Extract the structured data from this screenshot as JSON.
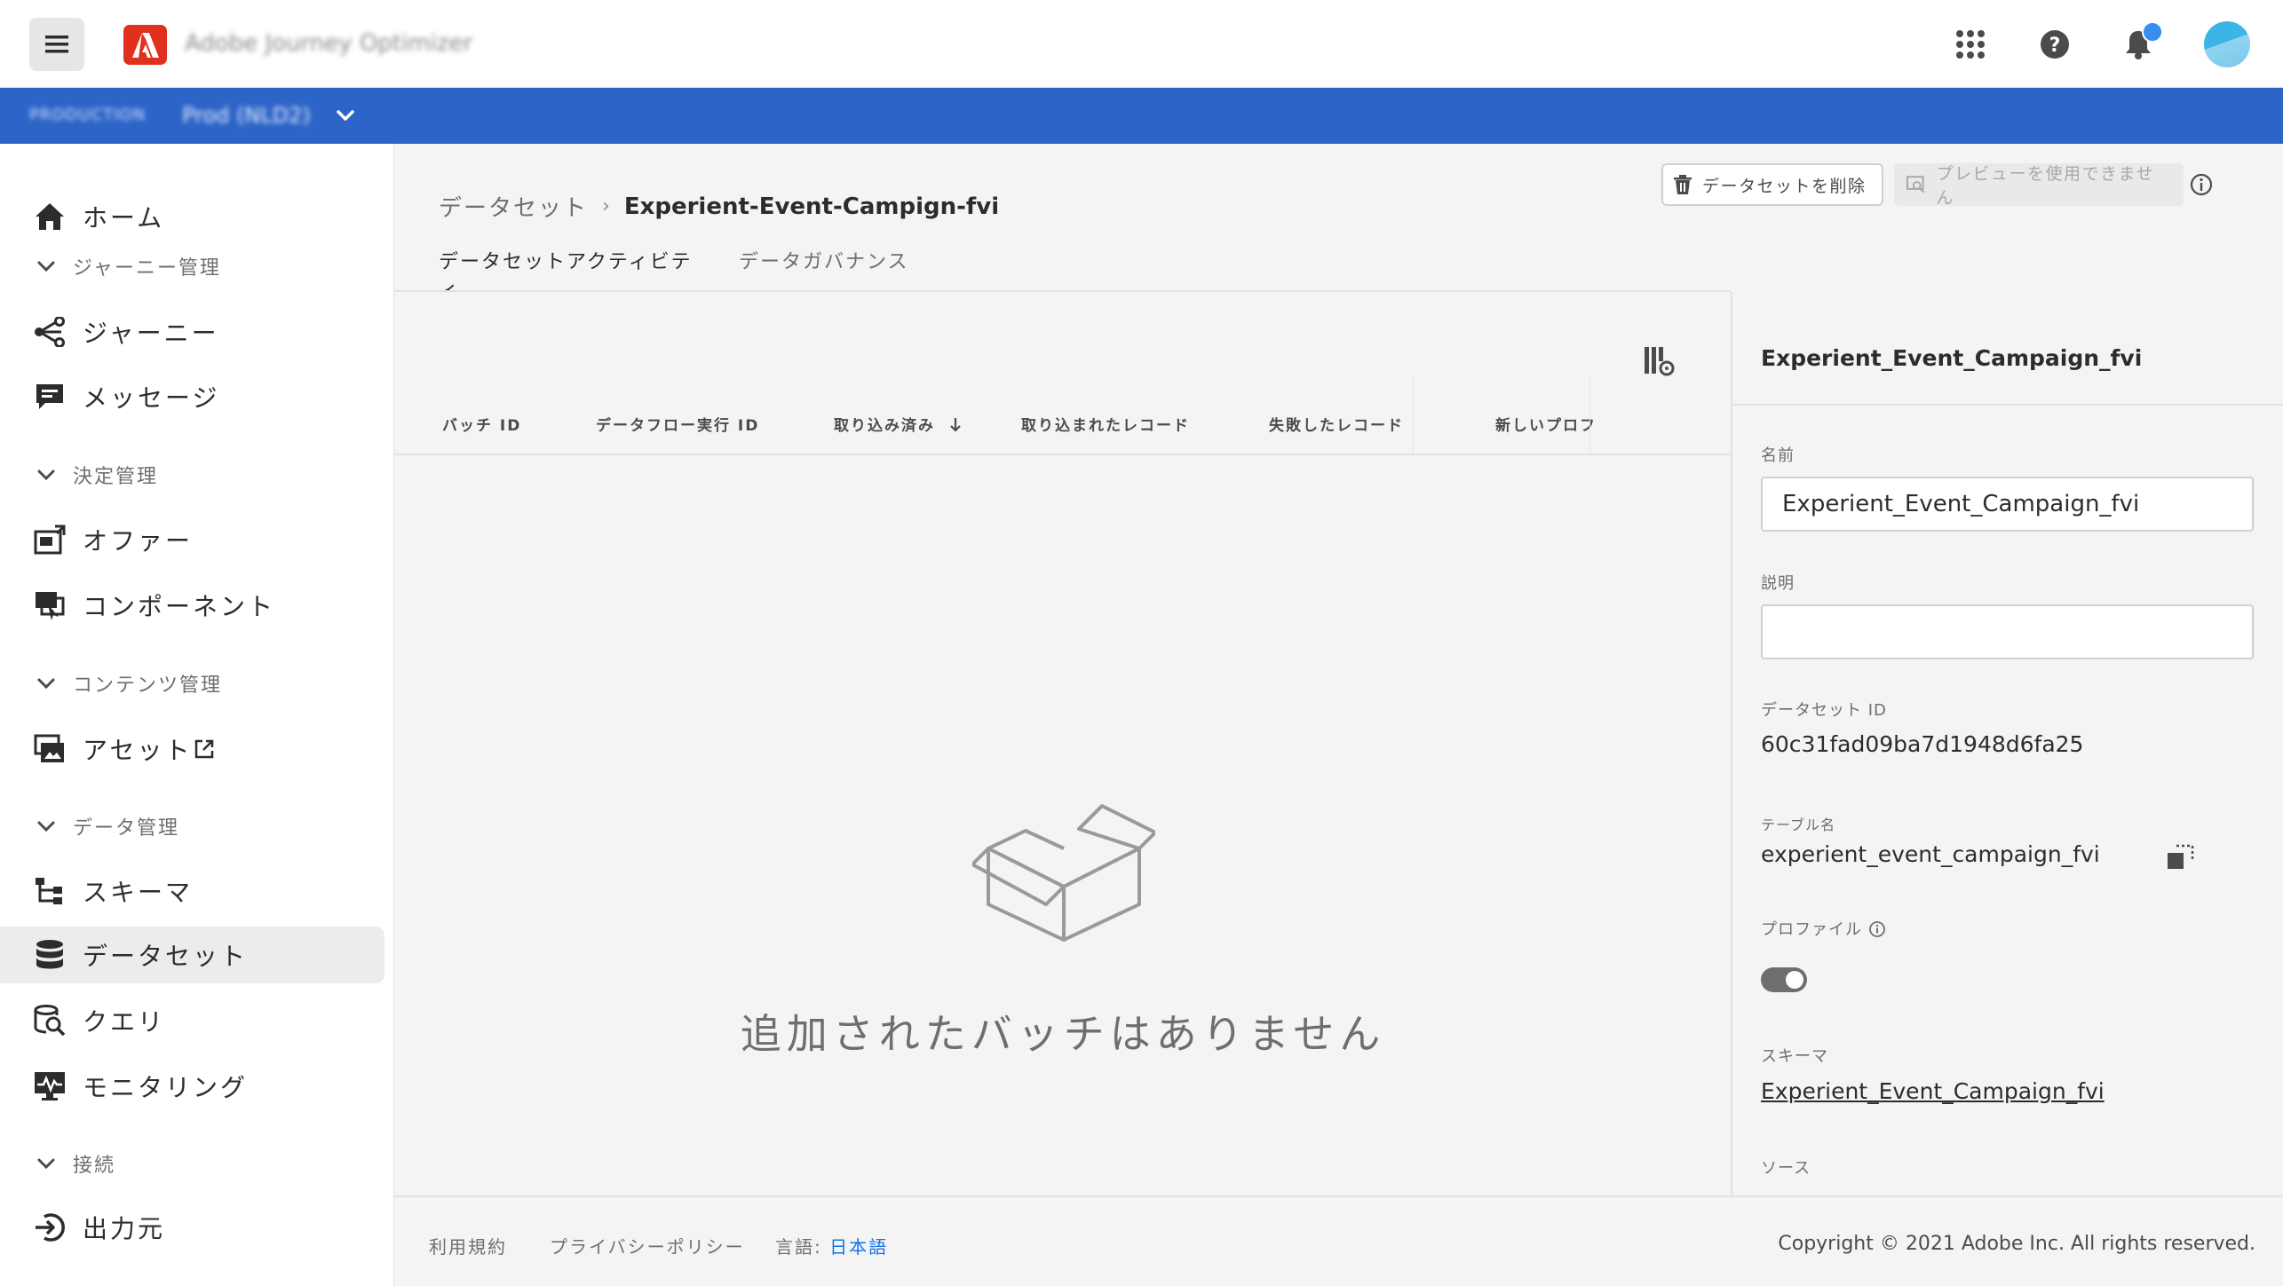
{
  "shell": {
    "app_name": "Adobe Journey Optimizer",
    "org_label": "PRODUCTION",
    "org_value": "Prod (NLD2)"
  },
  "sidebar": {
    "items": [
      {
        "type": "item",
        "label": "ホーム",
        "icon": "home-icon"
      },
      {
        "type": "section",
        "label": "ジャーニー管理"
      },
      {
        "type": "item",
        "label": "ジャーニー",
        "icon": "journey-icon"
      },
      {
        "type": "item",
        "label": "メッセージ",
        "icon": "message-icon"
      },
      {
        "type": "section",
        "label": "決定管理"
      },
      {
        "type": "item",
        "label": "オファー",
        "icon": "offer-icon"
      },
      {
        "type": "item",
        "label": "コンポーネント",
        "icon": "component-icon"
      },
      {
        "type": "section",
        "label": "コンテンツ管理"
      },
      {
        "type": "item",
        "label": "アセット",
        "icon": "assets-icon",
        "external": true
      },
      {
        "type": "section",
        "label": "データ管理"
      },
      {
        "type": "item",
        "label": "スキーマ",
        "icon": "schema-icon"
      },
      {
        "type": "item",
        "label": "データセット",
        "icon": "dataset-icon",
        "active": true
      },
      {
        "type": "item",
        "label": "クエリ",
        "icon": "query-icon"
      },
      {
        "type": "item",
        "label": "モニタリング",
        "icon": "monitoring-icon"
      },
      {
        "type": "section",
        "label": "接続"
      },
      {
        "type": "item",
        "label": "出力元",
        "icon": "sources-icon"
      }
    ]
  },
  "breadcrumb": {
    "parent": "データセット",
    "separator": "›",
    "current": "Experient-Event-Campign-fvi"
  },
  "tabs": [
    {
      "label": "データセットアクティビティ",
      "active": true
    },
    {
      "label": "データガバナンス",
      "active": false
    }
  ],
  "actions": {
    "delete_label": "データセットを削除",
    "preview_label": "プレビューを使用できません"
  },
  "table": {
    "columns": [
      "バッチ ID",
      "データフロー実行 ID",
      "取り込み済み",
      "取り込まれたレコード",
      "失敗したレコード",
      "新しいプロフ"
    ],
    "sorted_column": "取り込み済み",
    "sort_direction": "descending",
    "rows": [],
    "empty_message": "追加されたバッチはありません"
  },
  "panel": {
    "title": "Experient_Event_Campaign_fvi",
    "name_label": "名前",
    "name_value": "Experient_Event_Campaign_fvi",
    "description_label": "説明",
    "description_value": "",
    "dataset_id_label": "データセット ID",
    "dataset_id_value": "60c31fad09ba7d1948d6fa25",
    "table_name_label": "テーブル名",
    "table_name_value": "experient_event_campaign_fvi",
    "profile_label": "プロファイル",
    "profile_enabled": true,
    "schema_label": "スキーマ",
    "schema_value": "Experient_Event_Campaign_fvi",
    "source_label": "ソース"
  },
  "footer": {
    "terms": "利用規約",
    "privacy": "プライバシーポリシー",
    "language_label": "言語:",
    "language_value": "日本語",
    "copyright": "Copyright © 2021 Adobe Inc. All rights reserved."
  },
  "colors": {
    "org_bar": "#2d64c8",
    "adobe_red": "#e0301e",
    "link_blue": "#1473e6",
    "notification_dot": "#378ef0"
  }
}
